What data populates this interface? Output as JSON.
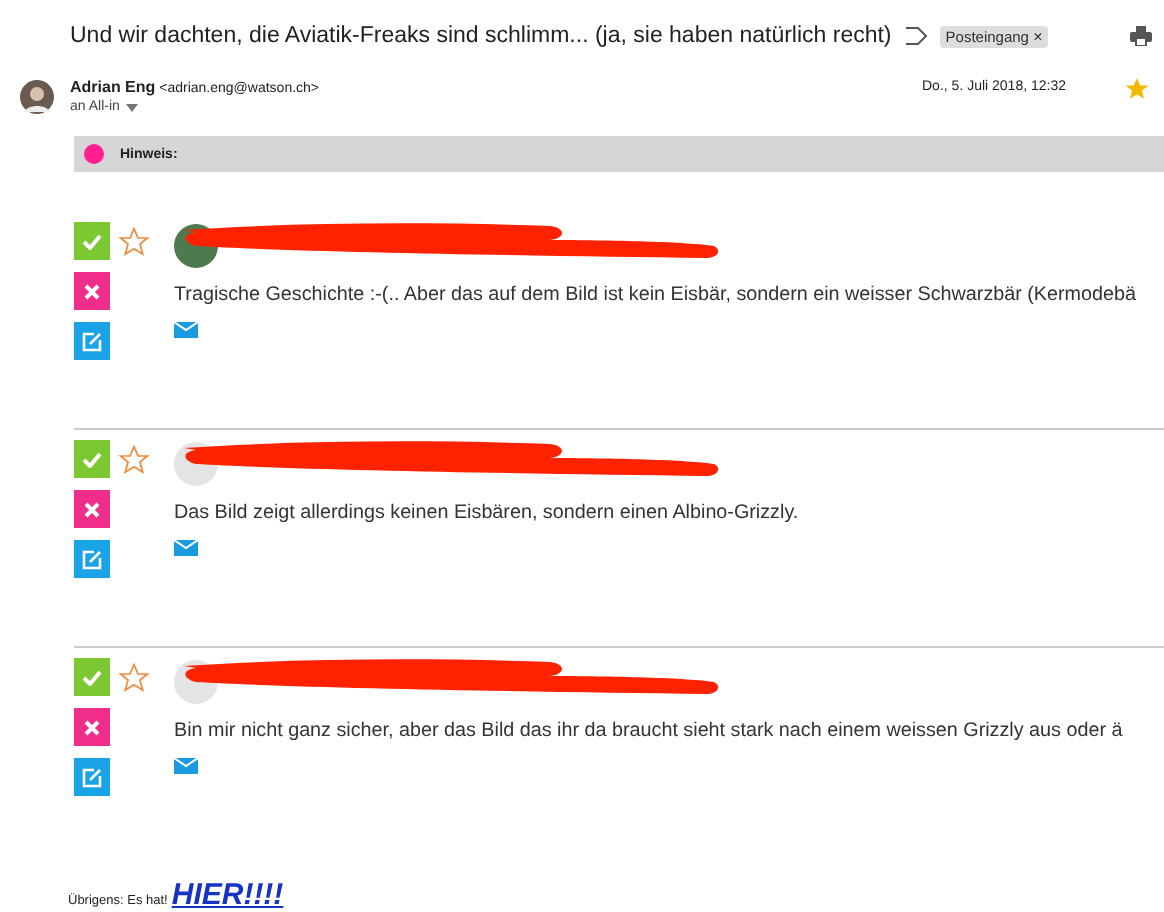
{
  "subject": "Und wir dachten, die Aviatik-Freaks sind schlimm... (ja, sie haben natürlich recht)",
  "folder_tag": {
    "label": "Posteingang",
    "remove": "×"
  },
  "sender": {
    "name": "Adrian Eng",
    "address": "<adrian.eng@watson.ch>",
    "recipient": "an All-in",
    "date": "Do., 5. Juli 2018, 12:32",
    "starred": true
  },
  "notice": {
    "label": "Hinweis:",
    "color": "#ff1f8e"
  },
  "comments": [
    {
      "text": "Tragische Geschichte :-(.. Aber das auf dem Bild ist kein Eisbär, sondern ein weisser Schwarzbär (Kermodebä",
      "starred": false
    },
    {
      "text": "Das Bild zeigt allerdings keinen Eisbären, sondern einen Albino-Grizzly.",
      "starred": false
    },
    {
      "text": "Bin mir nicht ganz sicher, aber das Bild das ihr da braucht sieht stark nach einem weissen Grizzly aus oder ä",
      "starred": false
    }
  ],
  "footer": {
    "text": "Übrigens: Es hat!",
    "link": "HIER!!!!"
  }
}
